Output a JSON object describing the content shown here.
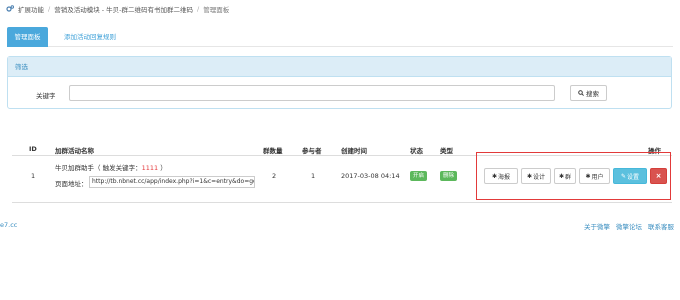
{
  "breadcrumb": {
    "items": [
      "扩展功能",
      "营销及活动模块 - 牛贝-群二维码有书加群二维码",
      "管理面板"
    ]
  },
  "tabs": [
    {
      "label": "管理面板",
      "active": true
    },
    {
      "label": "添加活动回复规则",
      "active": false
    }
  ],
  "filter": {
    "title": "筛选",
    "keyword_label": "关键字",
    "keyword_value": "",
    "search_label": "搜索"
  },
  "table": {
    "headers": {
      "id": "ID",
      "name": "加群活动名称",
      "groups": "群数量",
      "participants": "参与者",
      "created": "创建时间",
      "status": "状态",
      "type": "类型",
      "ops": "操作"
    },
    "rows": [
      {
        "id": "1",
        "name_prefix": "牛贝加群助手（ 触发关键字：",
        "keyword": "1111",
        "name_suffix": " ）",
        "url_label": "页面地址：",
        "url": "http://tb.nbnet.cc/app/index.php?i=1&c=entry&do=go&",
        "groups": "2",
        "participants": "1",
        "created": "2017-03-08 04:14",
        "status": "开启",
        "type": "删除"
      }
    ],
    "ops": {
      "poster": "海报",
      "design": "设计",
      "group": "群",
      "users": "用户",
      "settings": "设置",
      "delete": "×"
    }
  },
  "footer": {
    "left": "e7.cc",
    "links": [
      "关于微擎",
      "微擎论坛",
      "联系客服"
    ]
  },
  "colors": {
    "primary": "#4aa8dc",
    "success": "#5cb85c",
    "danger": "#d9534f",
    "info": "#5bc0de",
    "highlight_border": "#e23a3a"
  }
}
